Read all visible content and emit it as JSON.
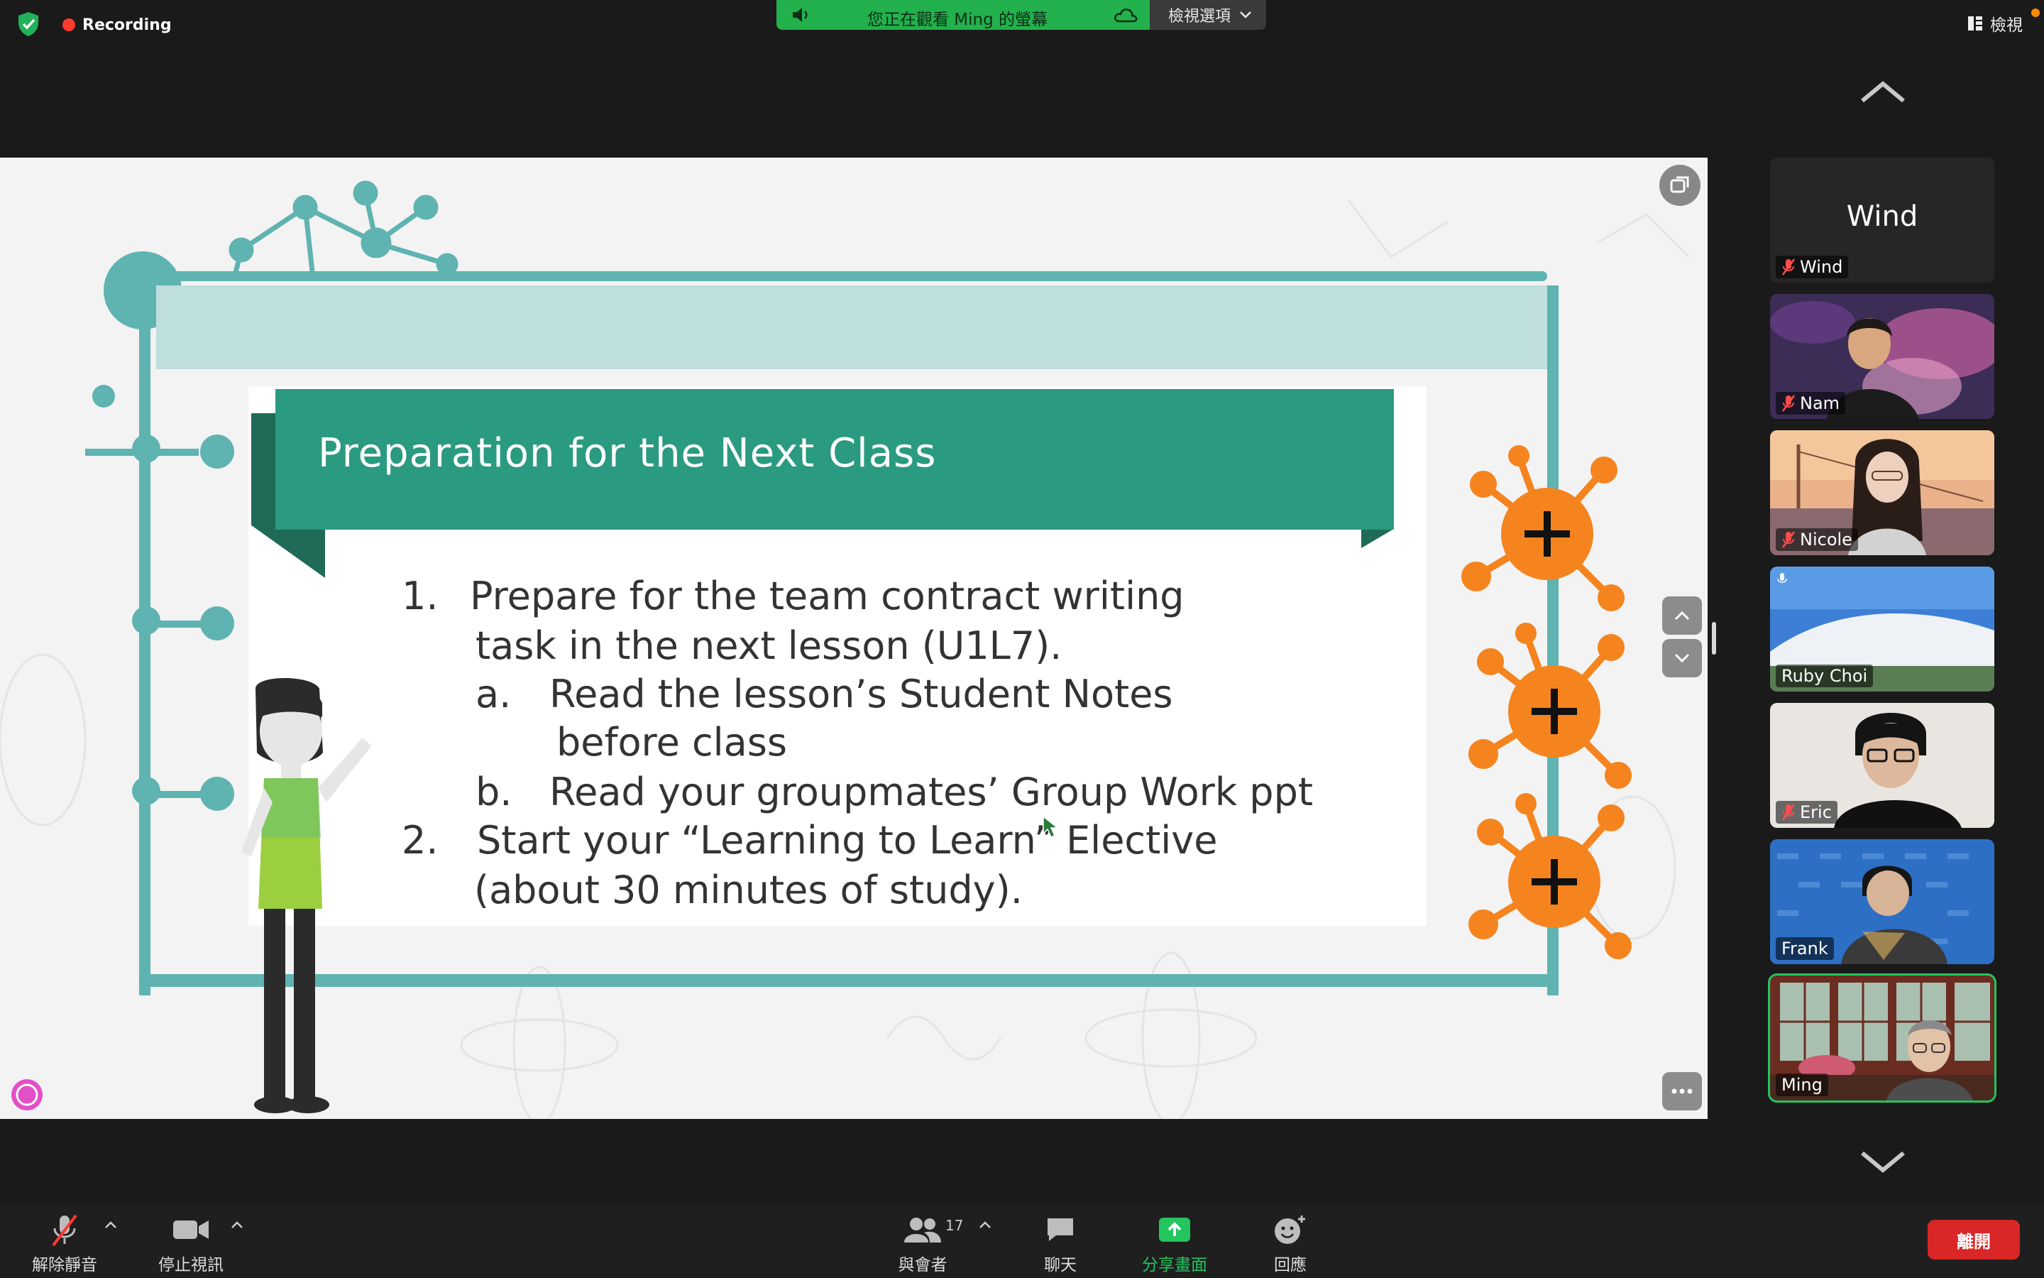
{
  "meeting": {
    "recording_label": "Recording",
    "banner_text": "您正在觀看 Ming 的螢幕",
    "view_options_label": "檢視選項",
    "view_label": "檢視"
  },
  "slide": {
    "title": "Preparation for the Next Class",
    "lines": [
      "1.",
      "Prepare for the team contract writing",
      "task in the next lesson (U1L7).",
      "a.",
      "Read the lesson’s Student Notes",
      "before class",
      "b.",
      "Read your groupmates’ Group Work ppt",
      "2.",
      "Start your “Learning to Learn” Elective",
      "(about 30 minutes of study)."
    ]
  },
  "participants": [
    {
      "name": "Wind",
      "big_name": "Wind",
      "muted": true
    },
    {
      "name": "Nam",
      "muted": true
    },
    {
      "name": "Nicole",
      "muted": true
    },
    {
      "name": "Ruby Choi",
      "muted": false
    },
    {
      "name": "Eric",
      "muted": true
    },
    {
      "name": "Frank",
      "muted": false
    },
    {
      "name": "Ming",
      "muted": false,
      "active_speaker": true
    }
  ],
  "toolbar": {
    "unmute_label": "解除靜音",
    "stop_video_label": "停止視訊",
    "participants_label": "與會者",
    "participants_count": "17",
    "chat_label": "聊天",
    "share_label": "分享畫面",
    "reactions_label": "回應",
    "leave_label": "離開"
  },
  "colors": {
    "share_green": "#22b14c",
    "leave_red": "#d92626",
    "slide_teal": "#2a9a80",
    "slide_frame": "#5fb3b0",
    "virus_orange": "#f5841f"
  }
}
